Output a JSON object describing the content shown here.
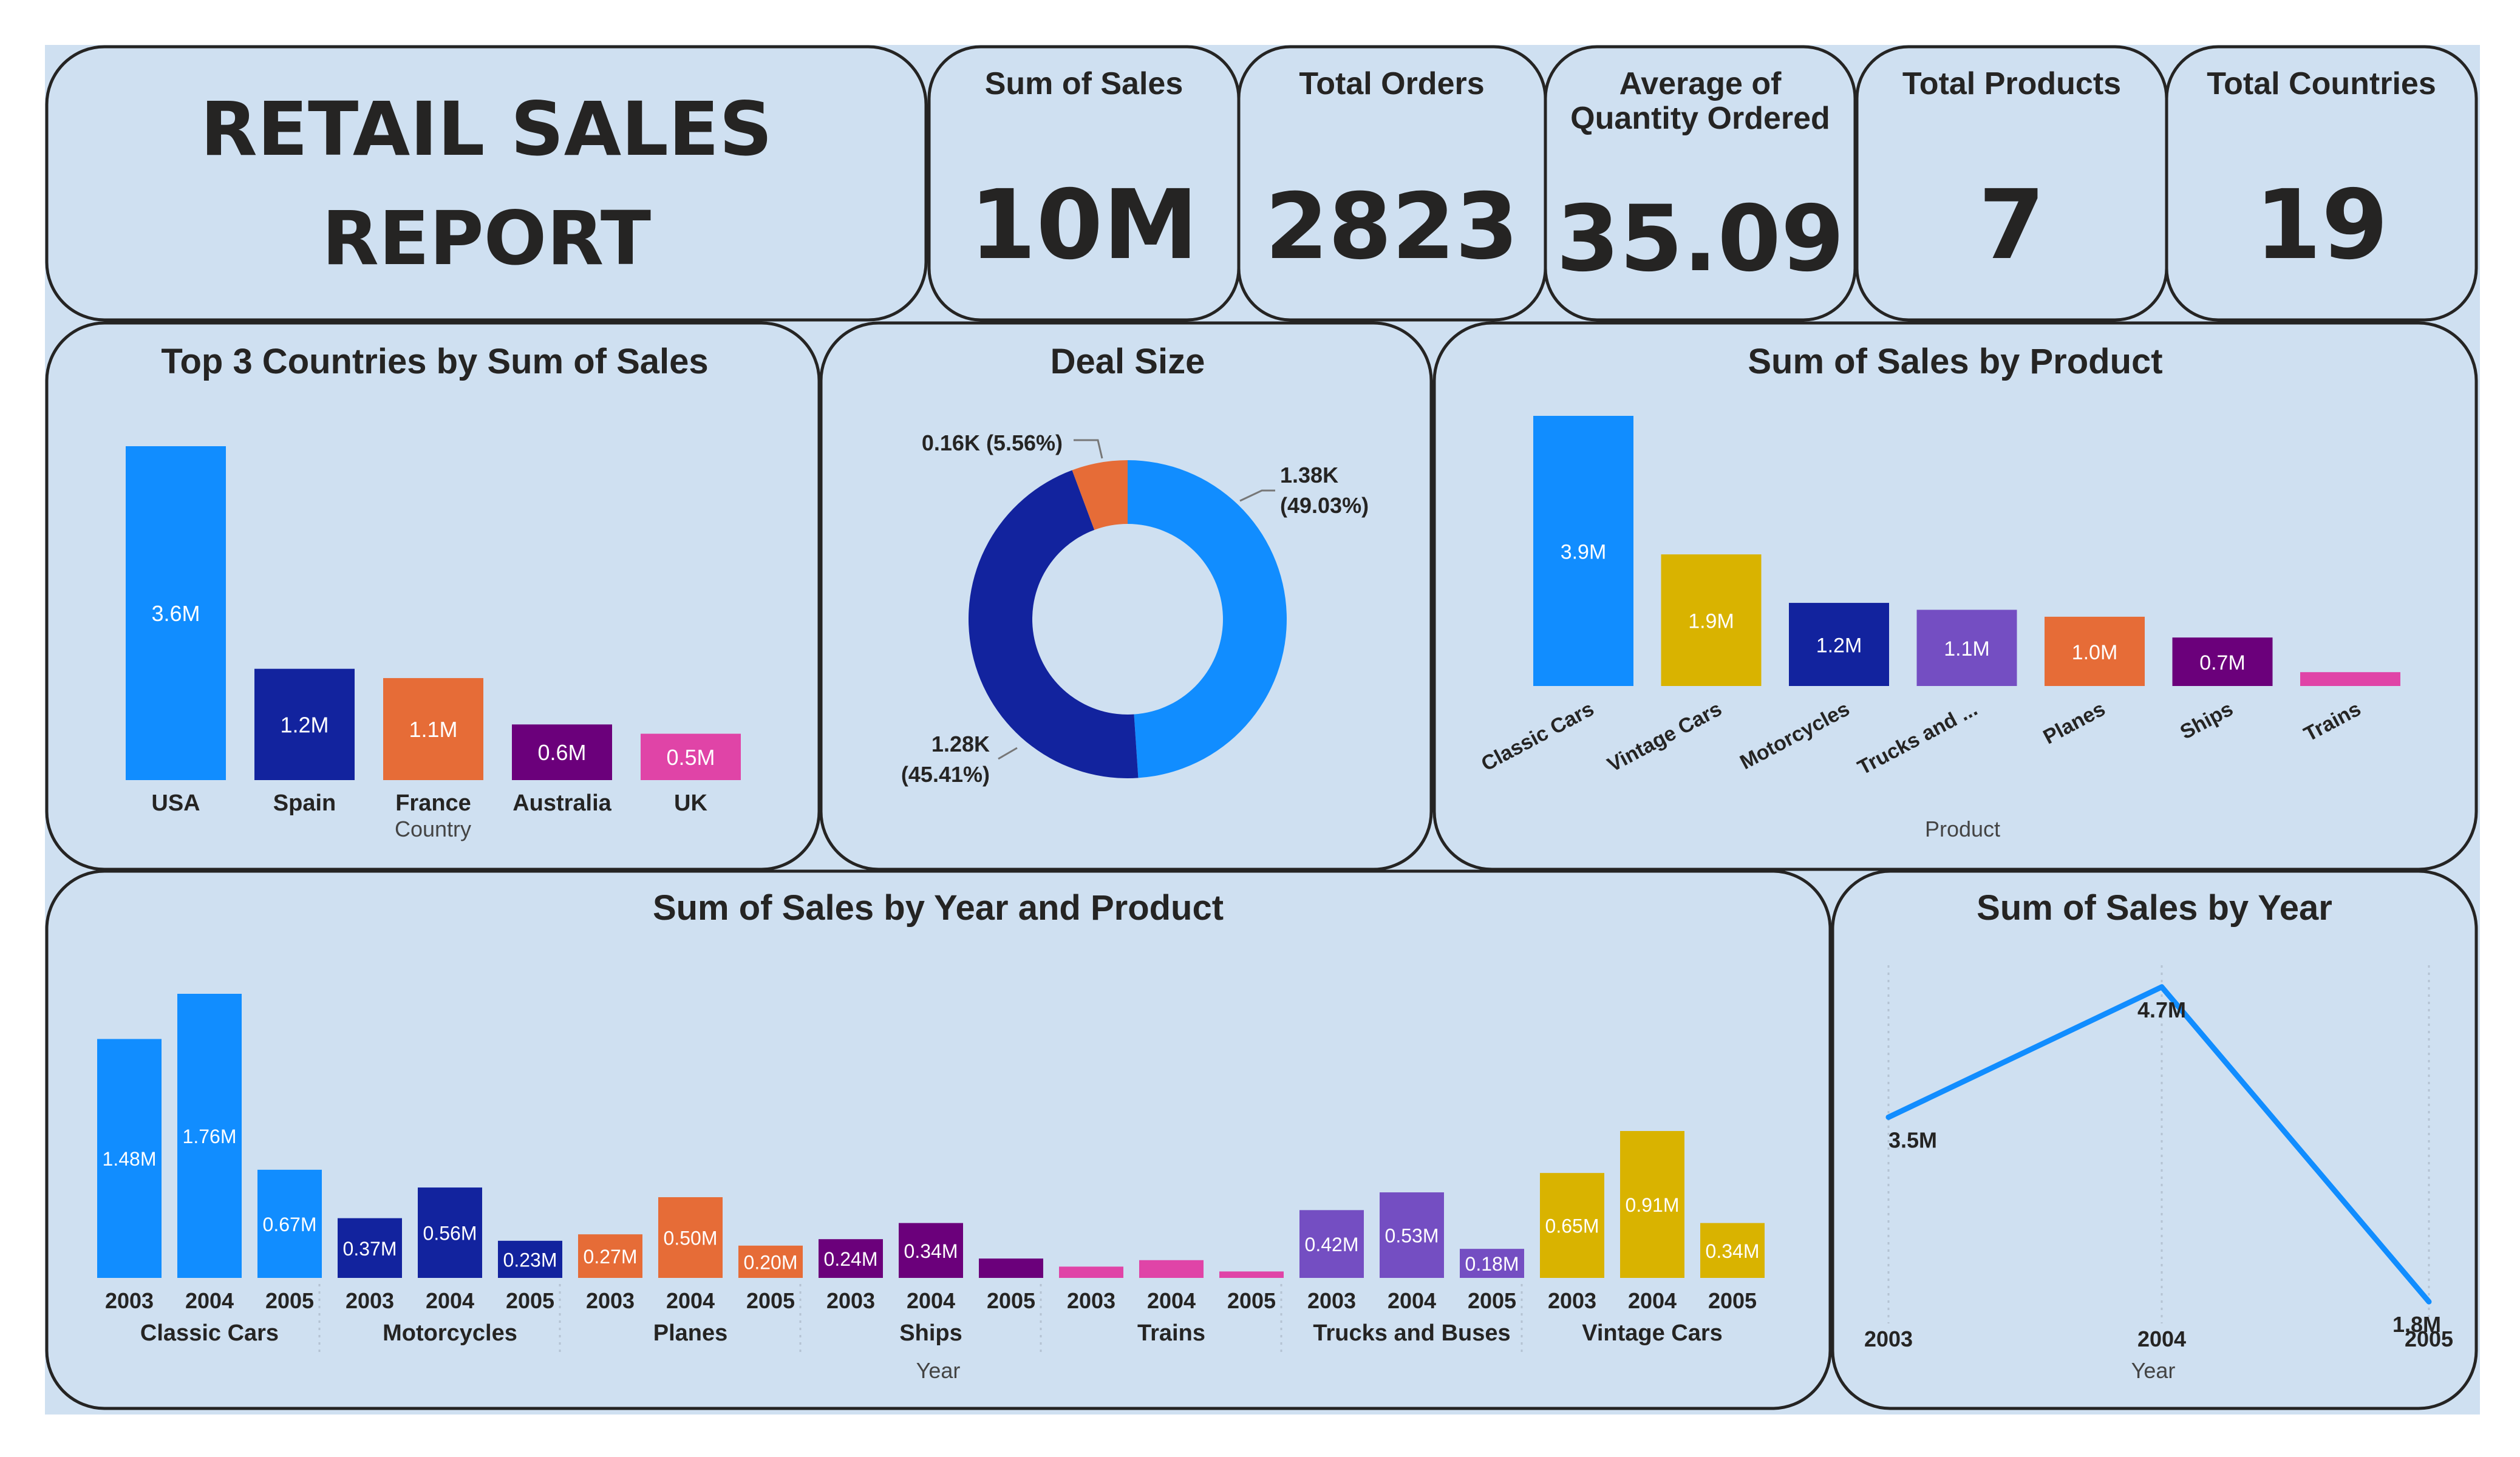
{
  "report": {
    "title_line1": "RETAIL SALES",
    "title_line2": "REPORT"
  },
  "kpis": [
    {
      "label_lines": [
        "Sum of Sales"
      ],
      "value": "10M"
    },
    {
      "label_lines": [
        "Total Orders"
      ],
      "value": "2823"
    },
    {
      "label_lines": [
        "Average of",
        "Quantity Ordered"
      ],
      "value": "35.09"
    },
    {
      "label_lines": [
        "Total Products"
      ],
      "value": "7"
    },
    {
      "label_lines": [
        "Total Countries"
      ],
      "value": "19"
    }
  ],
  "colors": {
    "page_bg": "#cfe0f1",
    "card_fill": "#cfe0f1",
    "card_border": "#252423",
    "blue": "#118dff",
    "navy": "#12239e",
    "orange": "#e66c37",
    "purple": "#6b007b",
    "pink": "#e044a7",
    "gold": "#d9b300",
    "violet": "#744ec2",
    "line": "#118dff"
  },
  "chart_data": [
    {
      "id": "top-countries",
      "type": "bar",
      "title": "Top 3 Countries by Sum of Sales",
      "xlabel": "Country",
      "ylabel": "",
      "categories": [
        "USA",
        "Spain",
        "France",
        "Australia",
        "UK"
      ],
      "values": [
        3.6,
        1.2,
        1.1,
        0.6,
        0.5
      ],
      "value_labels": [
        "3.6M",
        "1.2M",
        "1.1M",
        "0.6M",
        "0.5M"
      ],
      "colors": [
        "#118dff",
        "#12239e",
        "#e66c37",
        "#6b007b",
        "#e044a7"
      ],
      "unit": "M",
      "ylim": [
        0,
        3.6
      ]
    },
    {
      "id": "deal-size",
      "type": "pie",
      "title": "Deal Size",
      "slices": [
        {
          "value": 1.38,
          "pct": 49.03,
          "label_lines": [
            "1.38K",
            "(49.03%)"
          ],
          "color": "#118dff"
        },
        {
          "value": 1.28,
          "pct": 45.41,
          "label_lines": [
            "1.28K",
            "(45.41%)"
          ],
          "color": "#12239e"
        },
        {
          "value": 0.16,
          "pct": 5.56,
          "label_lines": [
            "0.16K (5.56%)"
          ],
          "color": "#e66c37"
        }
      ]
    },
    {
      "id": "sales-by-product",
      "type": "bar",
      "title": "Sum of Sales by Product",
      "xlabel": "Product",
      "ylabel": "",
      "categories": [
        "Classic Cars",
        "Vintage Cars",
        "Motorcycles",
        "Trucks and ...",
        "Planes",
        "Ships",
        "Trains"
      ],
      "values": [
        3.9,
        1.9,
        1.2,
        1.1,
        1.0,
        0.7,
        0.2
      ],
      "value_labels": [
        "3.9M",
        "1.9M",
        "1.2M",
        "1.1M",
        "1.0M",
        "0.7M",
        ""
      ],
      "colors": [
        "#118dff",
        "#d9b300",
        "#12239e",
        "#744ec2",
        "#e66c37",
        "#6b007b",
        "#e044a7"
      ],
      "unit": "M",
      "ylim": [
        0,
        3.9
      ]
    },
    {
      "id": "sales-by-year-product",
      "type": "bar",
      "title": "Sum of Sales by Year and Product",
      "xlabel": "Year",
      "ylabel": "",
      "groups": [
        {
          "name": "Classic Cars",
          "color": "#118dff",
          "years": [
            "2003",
            "2004",
            "2005"
          ],
          "values": [
            1.48,
            1.76,
            0.67
          ],
          "value_labels": [
            "1.48M",
            "1.76M",
            "0.67M"
          ]
        },
        {
          "name": "Motorcycles",
          "color": "#12239e",
          "years": [
            "2003",
            "2004",
            "2005"
          ],
          "values": [
            0.37,
            0.56,
            0.23
          ],
          "value_labels": [
            "0.37M",
            "0.56M",
            "0.23M"
          ]
        },
        {
          "name": "Planes",
          "color": "#e66c37",
          "years": [
            "2003",
            "2004",
            "2005"
          ],
          "values": [
            0.27,
            0.5,
            0.2
          ],
          "value_labels": [
            "0.27M",
            "0.50M",
            "0.20M"
          ]
        },
        {
          "name": "Ships",
          "color": "#6b007b",
          "years": [
            "2003",
            "2004",
            "2005"
          ],
          "values": [
            0.24,
            0.34,
            0.12
          ],
          "value_labels": [
            "0.24M",
            "0.34M",
            ""
          ]
        },
        {
          "name": "Trains",
          "color": "#e044a7",
          "years": [
            "2003",
            "2004",
            "2005"
          ],
          "values": [
            0.07,
            0.11,
            0.04
          ],
          "value_labels": [
            "",
            "",
            ""
          ]
        },
        {
          "name": "Trucks and Buses",
          "color": "#744ec2",
          "years": [
            "2003",
            "2004",
            "2005"
          ],
          "values": [
            0.42,
            0.53,
            0.18
          ],
          "value_labels": [
            "0.42M",
            "0.53M",
            "0.18M"
          ]
        },
        {
          "name": "Vintage Cars",
          "color": "#d9b300",
          "years": [
            "2003",
            "2004",
            "2005"
          ],
          "values": [
            0.65,
            0.91,
            0.34
          ],
          "value_labels": [
            "0.65M",
            "0.91M",
            "0.34M"
          ]
        }
      ],
      "unit": "M",
      "ylim": [
        0,
        1.76
      ]
    },
    {
      "id": "sales-by-year",
      "type": "line",
      "title": "Sum of Sales by Year",
      "xlabel": "Year",
      "ylabel": "",
      "x": [
        "2003",
        "2004",
        "2005"
      ],
      "y": [
        3.5,
        4.7,
        1.8
      ],
      "value_labels": [
        "3.5M",
        "4.7M",
        "1.8M"
      ],
      "color": "#118dff",
      "unit": "M",
      "grid": true
    }
  ]
}
